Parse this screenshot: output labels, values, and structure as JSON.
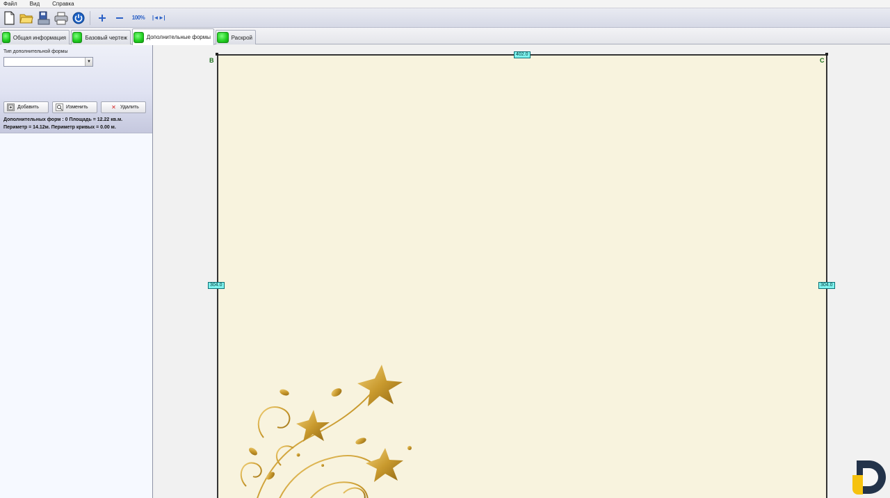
{
  "menu": {
    "items": [
      "Файл",
      "Вид",
      "Справка"
    ]
  },
  "toolbar": {
    "buttons": [
      "new-document-icon",
      "open-folder-icon",
      "save-icon",
      "print-icon",
      "power-icon",
      "zoom-in-icon",
      "zoom-out-icon",
      "zoom-100-icon",
      "fit-width-icon"
    ],
    "zoom_100_label": "100%",
    "fit_label": "|◄►|"
  },
  "tabs": [
    {
      "label": "Общая информация",
      "active": false
    },
    {
      "label": "Базовый чертеж",
      "active": false
    },
    {
      "label": "Дополнительные формы",
      "active": true
    },
    {
      "label": "Раскрой",
      "active": false
    }
  ],
  "left_panel": {
    "type_label": "Тип дополнительной формы",
    "type_value": "",
    "buttons": {
      "add": "Добавить",
      "edit": "Изменить",
      "delete": "Удалить"
    },
    "info_line1": "Дополнительных форм : 0 Площадь = 12.22 кв.м.",
    "info_line2": "Периметр = 14.12м. Периметр кривых = 0.00 м."
  },
  "canvas": {
    "corner_left": "B",
    "corner_right": "C",
    "dim_top": "402.0",
    "dim_left": "304.0",
    "dim_right": "304.0",
    "sheet_color": "#f8f3de"
  }
}
